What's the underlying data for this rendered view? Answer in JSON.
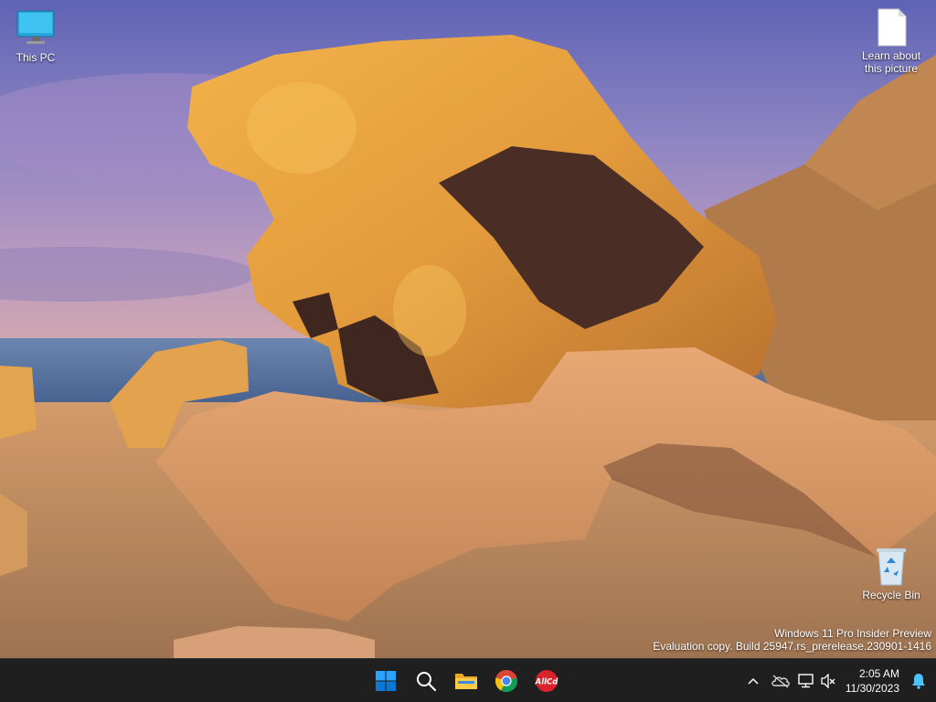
{
  "desktop": {
    "icons": [
      {
        "label": "This PC"
      },
      {
        "label": "Learn about this picture"
      },
      {
        "label": "Recycle Bin"
      }
    ],
    "watermark": {
      "line1": "Windows 11 Pro Insider Preview",
      "line2": "Evaluation copy. Build 25947.rs_prerelease.230901-1416"
    }
  },
  "taskbar": {
    "apps": [
      {
        "icon": "windows-start-icon"
      },
      {
        "icon": "search-icon"
      },
      {
        "icon": "file-explorer-icon"
      },
      {
        "icon": "chrome-icon"
      },
      {
        "icon": "allcd-icon",
        "text": "AllCd"
      }
    ],
    "tray": {
      "icons": [
        "chevron-up-icon",
        "onedrive-icon",
        "network-icon",
        "volume-muted-icon"
      ],
      "time": "2:05 AM",
      "date": "11/30/2023",
      "notification_icon": "bell-icon"
    }
  },
  "colors": {
    "taskbar_bg": "#1f1f1f",
    "accent_blue": "#0078d4",
    "notification_blue": "#4cc2ff"
  }
}
